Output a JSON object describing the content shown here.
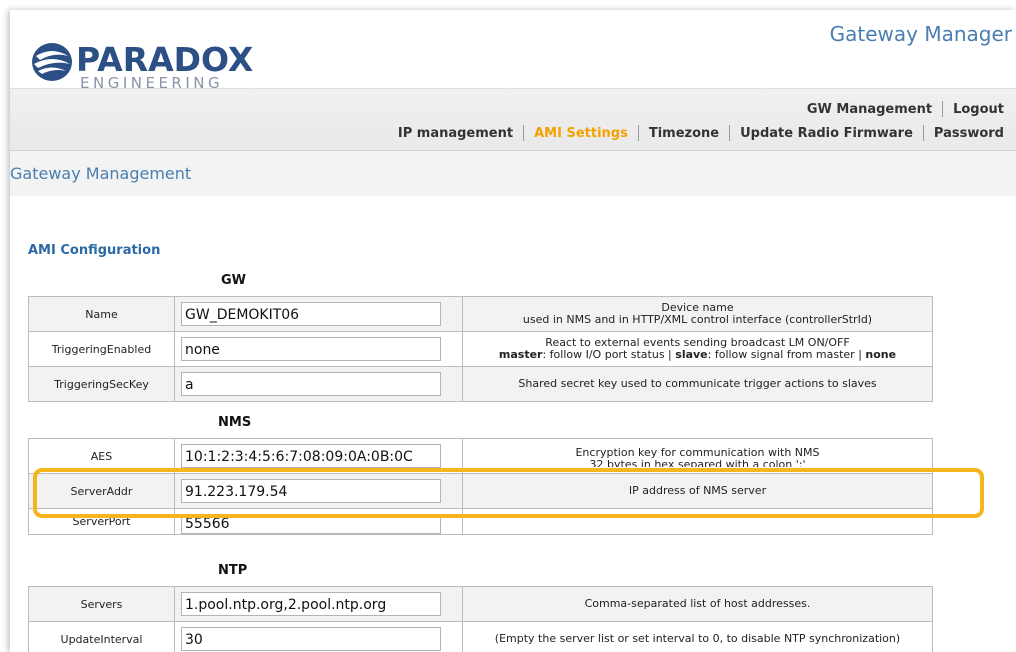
{
  "header": {
    "logo_brand": "PARADOX",
    "logo_sub": "ENGINEERING",
    "app_title": "Gateway Manager"
  },
  "nav": {
    "row1": [
      "GW Management",
      "Logout"
    ],
    "row2": [
      "IP management",
      "AMI Settings",
      "Timezone",
      "Update Radio Firmware",
      "Password"
    ],
    "active": "AMI Settings"
  },
  "page_title": "Gateway Management",
  "section_title": "AMI Configuration",
  "groups": {
    "gw": {
      "label": "GW",
      "rows": [
        {
          "label": "Name",
          "value": "GW_DEMOKIT06",
          "desc1": "Device name",
          "desc2": "used in NMS and in HTTP/XML control interface (controllerStrId)"
        },
        {
          "label": "TriggeringEnabled",
          "value": "none",
          "desc1": "React to external events sending broadcast LM ON/OFF",
          "desc2_master": "master",
          "desc2_a": ": follow I/O port status | ",
          "desc2_slave": "slave",
          "desc2_b": ": follow signal from master | ",
          "desc2_none": "none"
        },
        {
          "label": "TriggeringSecKey",
          "value": "a",
          "desc1": "Shared secret key used to communicate trigger actions to slaves"
        }
      ]
    },
    "nms": {
      "label": "NMS",
      "rows": [
        {
          "label": "AES",
          "value": "10:1:2:3:4:5:6:7:08:09:0A:0B:0C",
          "desc1": "Encryption key for communication with NMS",
          "desc2": "32 bytes in hex separed with a colon ':'"
        },
        {
          "label": "ServerAddr",
          "value": "91.223.179.54",
          "desc1": "IP address of NMS server"
        },
        {
          "label": "ServerPort",
          "value": "55566",
          "desc1": ""
        }
      ]
    },
    "ntp": {
      "label": "NTP",
      "rows": [
        {
          "label": "Servers",
          "value": "1.pool.ntp.org,2.pool.ntp.org",
          "desc1": "Comma-separated list of host addresses."
        },
        {
          "label": "UpdateInterval",
          "value": "30",
          "desc1": "(Empty the server list or set interval to 0, to disable NTP synchronization)"
        }
      ]
    }
  },
  "colors": {
    "brand": "#2c4f86",
    "accent": "#4a7eb0",
    "active_nav": "#f2a200",
    "highlight": "#f5b51c"
  }
}
